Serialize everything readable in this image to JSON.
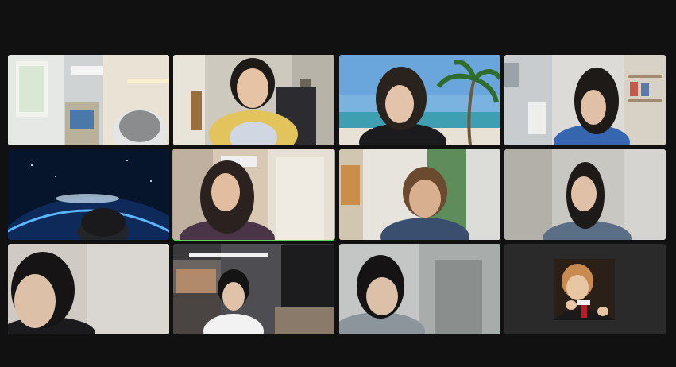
{
  "app": {
    "background_color": "#111111",
    "active_speaker_color": "#5bd45b"
  },
  "participants": [
    {
      "id": 1,
      "video": "on",
      "active_speaker": false
    },
    {
      "id": 2,
      "video": "on",
      "active_speaker": false
    },
    {
      "id": 3,
      "video": "on",
      "active_speaker": false,
      "background": "beach-virtual-background"
    },
    {
      "id": 4,
      "video": "on",
      "active_speaker": false
    },
    {
      "id": 5,
      "video": "on",
      "active_speaker": false,
      "background": "earth-space-virtual-background"
    },
    {
      "id": 6,
      "video": "on",
      "active_speaker": true
    },
    {
      "id": 7,
      "video": "on",
      "active_speaker": false
    },
    {
      "id": 8,
      "video": "on",
      "active_speaker": false
    },
    {
      "id": 9,
      "video": "on",
      "active_speaker": false
    },
    {
      "id": 10,
      "video": "on",
      "active_speaker": false
    },
    {
      "id": 11,
      "video": "on",
      "active_speaker": false
    },
    {
      "id": 12,
      "video": "off",
      "active_speaker": false,
      "profile_picture": "avatar-photo"
    }
  ]
}
